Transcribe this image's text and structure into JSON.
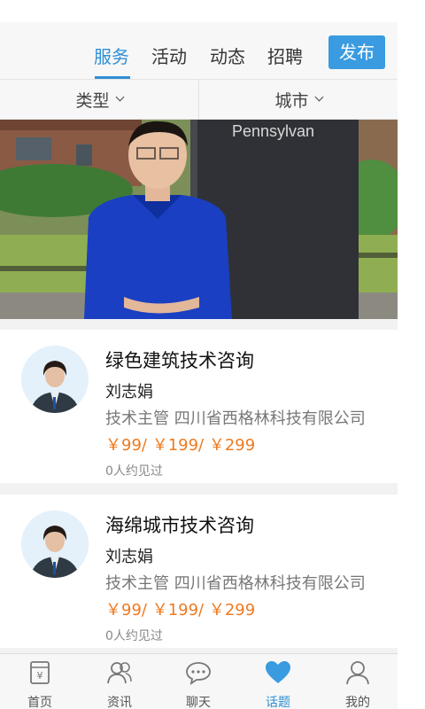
{
  "top_tabs": [
    {
      "label": "服务",
      "active": true
    },
    {
      "label": "活动",
      "active": false
    },
    {
      "label": "动态",
      "active": false
    },
    {
      "label": "招聘",
      "active": false
    }
  ],
  "publish_label": "发布",
  "filters": {
    "type_label": "类型",
    "city_label": "城市"
  },
  "banner": {
    "sign_text": "Pennsylvan"
  },
  "cards": [
    {
      "title": "绿色建筑技术咨询",
      "name": "刘志娟",
      "desc": "技术主管 四川省西格林科技有限公司",
      "price": "￥99/ ￥199/ ￥299",
      "met": "0人约见过"
    },
    {
      "title": "海绵城市技术咨询",
      "name": "刘志娟",
      "desc": "技术主管 四川省西格林科技有限公司",
      "price": "￥99/ ￥199/ ￥299",
      "met": "0人约见过"
    }
  ],
  "bottom_tabs": [
    {
      "label": "首页",
      "icon": "home-yen-icon"
    },
    {
      "label": "资讯",
      "icon": "people-icon"
    },
    {
      "label": "聊天",
      "icon": "chat-bubble-icon"
    },
    {
      "label": "话题",
      "icon": "heart-icon",
      "active": true
    },
    {
      "label": "我的",
      "icon": "person-icon"
    }
  ],
  "colors": {
    "accent": "#2e8fd6",
    "price": "#ee7a1f",
    "background": "#f2f2f2"
  }
}
